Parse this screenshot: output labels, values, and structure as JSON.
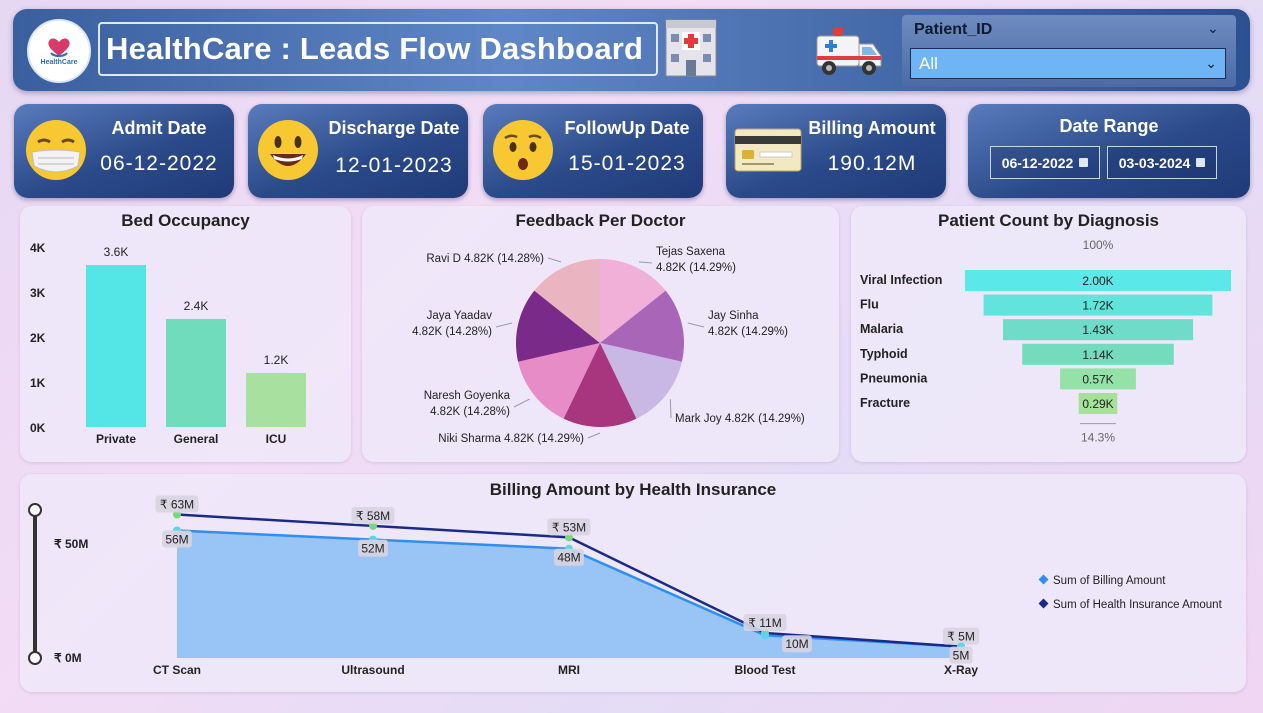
{
  "header": {
    "logo_text": "HealthCare",
    "title": "HealthCare : Leads Flow Dashboard",
    "hospital_icon": "hospital-icon",
    "ambulance_icon": "ambulance-icon"
  },
  "filter": {
    "label": "Patient_ID",
    "value": "All"
  },
  "kpis": {
    "admit": {
      "title": "Admit Date",
      "value": "06-12-2022",
      "icon": "face-with-mask-emoji"
    },
    "discharge": {
      "title": "Discharge Date",
      "value": "12-01-2023",
      "icon": "smiling-face-emoji"
    },
    "followup": {
      "title": "FollowUp Date",
      "value": "15-01-2023",
      "icon": "hushed-face-emoji"
    },
    "billing": {
      "title": "Billing Amount",
      "value": "190.12M",
      "icon": "credit-card-icon"
    }
  },
  "date_range": {
    "title": "Date Range",
    "start": "06-12-2022",
    "end": "03-03-2024"
  },
  "colors": {
    "kpi_bg": "#2b4a8a",
    "bar_private": "#54e6e6",
    "bar_general": "#71dcbc",
    "bar_icu": "#a8e0a0",
    "area_fill": "#8fc0f5",
    "billing_line": "#2f8ff0",
    "insurance_line": "#1a2a8a"
  },
  "chart_data": [
    {
      "id": "bed-occupancy",
      "type": "bar",
      "title": "Bed Occupancy",
      "categories": [
        "Private",
        "General",
        "ICU"
      ],
      "values": [
        3600,
        2400,
        1200
      ],
      "data_labels": [
        "3.6K",
        "2.4K",
        "1.2K"
      ],
      "yticks": [
        "0K",
        "1K",
        "2K",
        "3K",
        "4K"
      ],
      "ylim": [
        0,
        4000
      ]
    },
    {
      "id": "feedback-per-doctor",
      "type": "pie",
      "title": "Feedback Per Doctor",
      "slices": [
        {
          "name": "Tejas Saxena",
          "label": "4.82K (14.29%)",
          "value": 4820,
          "color": "#f0b0d8"
        },
        {
          "name": "Jay Sinha",
          "label": "4.82K (14.29%)",
          "value": 4820,
          "color": "#a966b8"
        },
        {
          "name": "Mark Joy",
          "label": "4.82K (14.29%)",
          "value": 4820,
          "color": "#c9b8e6"
        },
        {
          "name": "Niki Sharma",
          "label": "4.82K (14.29%)",
          "value": 4820,
          "color": "#a8367e"
        },
        {
          "name": "Naresh Goyenka",
          "label": "4.82K (14.28%)",
          "value": 4820,
          "color": "#e88cc8"
        },
        {
          "name": "Jaya Yaadav",
          "label": "4.82K (14.28%)",
          "value": 4820,
          "color": "#7a2a88"
        },
        {
          "name": "Ravi D",
          "label": "4.82K (14.28%)",
          "value": 4820,
          "color": "#eab4c0"
        }
      ]
    },
    {
      "id": "patient-count-by-diagnosis",
      "type": "bar",
      "title": "Patient Count by Diagnosis",
      "top_label": "100%",
      "bottom_label": "14.3%",
      "categories": [
        "Viral Infection",
        "Flu",
        "Malaria",
        "Typhoid",
        "Pneumonia",
        "Fracture"
      ],
      "values": [
        2000,
        1720,
        1430,
        1140,
        570,
        290
      ],
      "data_labels": [
        "2.00K",
        "1.72K",
        "1.43K",
        "1.14K",
        "0.57K",
        "0.29K"
      ],
      "colors": [
        "#5ae8e8",
        "#62e4dc",
        "#6edcc8",
        "#74dcbc",
        "#94e2a8",
        "#a6e09a"
      ]
    },
    {
      "id": "billing-by-insurance",
      "type": "area",
      "title": "Billing Amount by Health Insurance",
      "categories": [
        "CT Scan",
        "Ultrasound",
        "MRI",
        "Blood Test",
        "X-Ray"
      ],
      "yticks": [
        "₹ 0M",
        "₹ 50M"
      ],
      "ylim": [
        0,
        65
      ],
      "series": [
        {
          "name": "Sum of Billing Amount",
          "values": [
            56,
            52,
            48,
            10,
            5
          ],
          "labels": [
            "56M",
            "52M",
            "48M",
            "10M",
            "5M"
          ]
        },
        {
          "name": "Sum of Health Insurance Amount",
          "values": [
            63,
            58,
            53,
            11,
            5
          ],
          "labels": [
            "₹ 63M",
            "₹ 58M",
            "₹ 53M",
            "₹ 11M",
            "₹ 5M"
          ]
        }
      ],
      "legend": "right"
    }
  ]
}
